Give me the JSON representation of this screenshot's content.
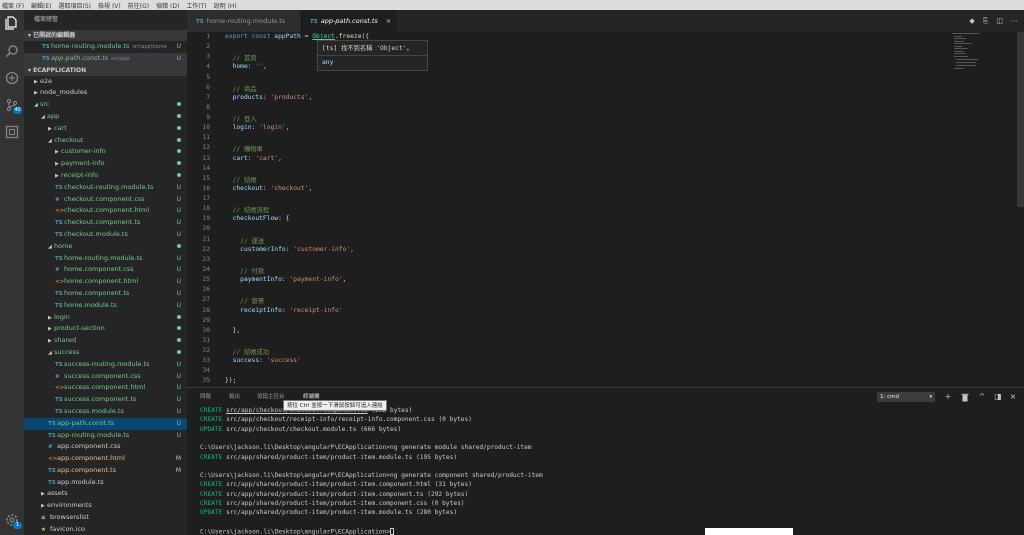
{
  "menu": [
    "檔案 (F)",
    "編輯(E)",
    "選取項目(S)",
    "檢視 (V)",
    "前往(G)",
    "偵錯 (D)",
    "工作(T)",
    "說明 (H)"
  ],
  "activity": {
    "scm_badge": "40",
    "settings_badge": "1"
  },
  "sidebar": {
    "title": "檔案總管",
    "open_editors_header": "已開啟的編輯器",
    "open_editors": [
      {
        "name": "home-routing.module.ts",
        "desc": "src\\app\\home",
        "status": "U"
      },
      {
        "name": "app-path.const.ts",
        "desc": "src\\app",
        "status": "U"
      }
    ],
    "project_header": "ECAPPLICATION",
    "tree": [
      {
        "name": "e2e",
        "type": "folder",
        "level": 0,
        "expanded": false,
        "status": ""
      },
      {
        "name": "node_modules",
        "type": "folder",
        "level": 0,
        "expanded": false,
        "status": ""
      },
      {
        "name": "src",
        "type": "folder",
        "level": 0,
        "expanded": true,
        "status": "dot"
      },
      {
        "name": "app",
        "type": "folder",
        "level": 1,
        "expanded": true,
        "status": "dot"
      },
      {
        "name": "cart",
        "type": "folder",
        "level": 2,
        "expanded": false,
        "status": "dot"
      },
      {
        "name": "checkout",
        "type": "folder",
        "level": 2,
        "expanded": true,
        "status": "dot"
      },
      {
        "name": "customer-info",
        "type": "folder",
        "level": 3,
        "expanded": false,
        "status": "dot"
      },
      {
        "name": "payment-info",
        "type": "folder",
        "level": 3,
        "expanded": false,
        "status": "dot"
      },
      {
        "name": "receipt-info",
        "type": "folder",
        "level": 3,
        "expanded": false,
        "status": "dot"
      },
      {
        "name": "checkout-routing.module.ts",
        "type": "ts",
        "level": 3,
        "status": "U"
      },
      {
        "name": "checkout.component.css",
        "type": "css",
        "level": 3,
        "status": "U"
      },
      {
        "name": "checkout.component.html",
        "type": "html",
        "level": 3,
        "status": "U"
      },
      {
        "name": "checkout.component.ts",
        "type": "ts",
        "level": 3,
        "status": "U"
      },
      {
        "name": "checkout.module.ts",
        "type": "ts",
        "level": 3,
        "status": "U"
      },
      {
        "name": "home",
        "type": "folder",
        "level": 2,
        "expanded": true,
        "status": "dot"
      },
      {
        "name": "home-routing.module.ts",
        "type": "ts",
        "level": 3,
        "status": "U"
      },
      {
        "name": "home.component.css",
        "type": "css",
        "level": 3,
        "status": "U"
      },
      {
        "name": "home.component.html",
        "type": "html",
        "level": 3,
        "status": "U"
      },
      {
        "name": "home.component.ts",
        "type": "ts",
        "level": 3,
        "status": "U"
      },
      {
        "name": "home.module.ts",
        "type": "ts",
        "level": 3,
        "status": "U"
      },
      {
        "name": "login",
        "type": "folder",
        "level": 2,
        "expanded": false,
        "status": "dot"
      },
      {
        "name": "product-section",
        "type": "folder",
        "level": 2,
        "expanded": false,
        "status": "dot"
      },
      {
        "name": "shared",
        "type": "folder",
        "level": 2,
        "expanded": false,
        "status": "dot"
      },
      {
        "name": "success",
        "type": "folder",
        "level": 2,
        "expanded": true,
        "status": "dot"
      },
      {
        "name": "success-routing.module.ts",
        "type": "ts",
        "level": 3,
        "status": "U"
      },
      {
        "name": "success.component.css",
        "type": "css",
        "level": 3,
        "status": "U"
      },
      {
        "name": "success.component.html",
        "type": "html",
        "level": 3,
        "status": "U"
      },
      {
        "name": "success.component.ts",
        "type": "ts",
        "level": 3,
        "status": "U"
      },
      {
        "name": "success.module.ts",
        "type": "ts",
        "level": 3,
        "status": "U"
      },
      {
        "name": "app-path.const.ts",
        "type": "ts",
        "level": 2,
        "status": "U",
        "selected": true
      },
      {
        "name": "app-routing.module.ts",
        "type": "ts",
        "level": 2,
        "status": "U"
      },
      {
        "name": "app.component.css",
        "type": "css",
        "level": 2,
        "status": ""
      },
      {
        "name": "app.component.html",
        "type": "html",
        "level": 2,
        "status": "M"
      },
      {
        "name": "app.component.ts",
        "type": "ts",
        "level": 2,
        "status": "M"
      },
      {
        "name": "app.module.ts",
        "type": "ts",
        "level": 2,
        "status": ""
      },
      {
        "name": "assets",
        "type": "folder",
        "level": 1,
        "expanded": false,
        "status": ""
      },
      {
        "name": "environments",
        "type": "folder",
        "level": 1,
        "expanded": false,
        "status": ""
      },
      {
        "name": "browserslist",
        "type": "file",
        "level": 1,
        "status": ""
      },
      {
        "name": "favicon.ico",
        "type": "star",
        "level": 1,
        "status": ""
      }
    ]
  },
  "tabs": [
    {
      "label": "home-routing.module.ts",
      "active": false
    },
    {
      "label": "app-path.const.ts",
      "active": true
    }
  ],
  "editor": {
    "lines": [
      {
        "n": "1",
        "t": [
          [
            "k",
            "export "
          ],
          [
            "k",
            "const "
          ],
          [
            "v",
            "appPath"
          ],
          [
            "p",
            " = "
          ],
          [
            "obj",
            "Object"
          ],
          [
            "p",
            "."
          ],
          [
            "f",
            "freeze"
          ],
          [
            "p",
            "({"
          ]
        ]
      },
      {
        "n": "2",
        "t": []
      },
      {
        "n": "3",
        "t": [
          [
            "c",
            "  // 首頁"
          ]
        ]
      },
      {
        "n": "4",
        "t": [
          [
            "v",
            "  home"
          ],
          [
            "p",
            ": "
          ],
          [
            "s",
            "''"
          ],
          [
            "p",
            ","
          ]
        ]
      },
      {
        "n": "5",
        "t": []
      },
      {
        "n": "6",
        "t": [
          [
            "c",
            "  // 商品"
          ]
        ]
      },
      {
        "n": "7",
        "t": [
          [
            "v",
            "  products"
          ],
          [
            "p",
            ": "
          ],
          [
            "s",
            "'products'"
          ],
          [
            "p",
            ","
          ]
        ]
      },
      {
        "n": "8",
        "t": []
      },
      {
        "n": "9",
        "t": [
          [
            "c",
            "  // 登入"
          ]
        ]
      },
      {
        "n": "10",
        "t": [
          [
            "v",
            "  login"
          ],
          [
            "p",
            ": "
          ],
          [
            "s",
            "'login'"
          ],
          [
            "p",
            ","
          ]
        ]
      },
      {
        "n": "11",
        "t": []
      },
      {
        "n": "12",
        "t": [
          [
            "c",
            "  // 購物車"
          ]
        ]
      },
      {
        "n": "13",
        "t": [
          [
            "v",
            "  cart"
          ],
          [
            "p",
            ": "
          ],
          [
            "s",
            "'cart'"
          ],
          [
            "p",
            ","
          ]
        ]
      },
      {
        "n": "14",
        "t": []
      },
      {
        "n": "15",
        "t": [
          [
            "c",
            "  // 結帳"
          ]
        ]
      },
      {
        "n": "16",
        "t": [
          [
            "v",
            "  checkout"
          ],
          [
            "p",
            ": "
          ],
          [
            "s",
            "'checkout'"
          ],
          [
            "p",
            ","
          ]
        ]
      },
      {
        "n": "17",
        "t": []
      },
      {
        "n": "18",
        "t": [
          [
            "c",
            "  // 結帳流程"
          ]
        ]
      },
      {
        "n": "19",
        "t": [
          [
            "v",
            "  checkoutFlow"
          ],
          [
            "p",
            ": {"
          ]
        ]
      },
      {
        "n": "20",
        "t": []
      },
      {
        "n": "21",
        "t": [
          [
            "c",
            "    // 運送"
          ]
        ]
      },
      {
        "n": "22",
        "t": [
          [
            "v",
            "    customerInfo"
          ],
          [
            "p",
            ": "
          ],
          [
            "s",
            "'customer-info'"
          ],
          [
            "p",
            ","
          ]
        ]
      },
      {
        "n": "23",
        "t": []
      },
      {
        "n": "24",
        "t": [
          [
            "c",
            "    // 付款"
          ]
        ]
      },
      {
        "n": "25",
        "t": [
          [
            "v",
            "    paymentInfo"
          ],
          [
            "p",
            ": "
          ],
          [
            "s",
            "'payment-info'"
          ],
          [
            "p",
            ","
          ]
        ]
      },
      {
        "n": "26",
        "t": []
      },
      {
        "n": "27",
        "t": [
          [
            "c",
            "    // 發票"
          ]
        ]
      },
      {
        "n": "28",
        "t": [
          [
            "v",
            "    receiptInfo"
          ],
          [
            "p",
            ": "
          ],
          [
            "s",
            "'receipt-info'"
          ]
        ]
      },
      {
        "n": "29",
        "t": []
      },
      {
        "n": "30",
        "t": [
          [
            "p",
            "  },"
          ]
        ]
      },
      {
        "n": "31",
        "t": []
      },
      {
        "n": "32",
        "t": [
          [
            "c",
            "  // 結帳成功"
          ]
        ]
      },
      {
        "n": "33",
        "t": [
          [
            "v",
            "  success"
          ],
          [
            "p",
            ": "
          ],
          [
            "s",
            "'success'"
          ]
        ]
      },
      {
        "n": "34",
        "t": []
      },
      {
        "n": "35",
        "t": [
          [
            "p",
            "});"
          ]
        ]
      }
    ],
    "hover_title": "[ts] 找不到名稱 'Object'。",
    "hover_type": "any"
  },
  "panel": {
    "tabs": [
      "問題",
      "輸出",
      "偵錯主控台",
      "終端機"
    ],
    "active_tab": "終端機",
    "terminal_select": "1: cmd",
    "tooltip": "按住 Ctrl 並按一下滑鼠按鈕可追入連結",
    "lines": [
      {
        "kind": "CREATE",
        "path": "src/app/checkout/checkout.component.ts",
        "rest": " (292 bytes)"
      },
      {
        "kind": "CREATE",
        "path": "src/app/checkout/receipt-info/receipt-info.component.css",
        "rest": " (0 bytes)"
      },
      {
        "kind": "UPDATE",
        "path": "src/app/checkout/checkout.module.ts",
        "rest": " (666 bytes)"
      },
      {
        "kind": "",
        "path": "",
        "rest": ""
      },
      {
        "kind": "",
        "path": "",
        "rest": "C:\\Users\\jackson.li\\Desktop\\angularP\\ECApplication>ng generate module shared/product-item"
      },
      {
        "kind": "CREATE",
        "path": "src/app/shared/product-item/product-item.module.ts",
        "rest": " (195 bytes)"
      },
      {
        "kind": "",
        "path": "",
        "rest": ""
      },
      {
        "kind": "",
        "path": "",
        "rest": "C:\\Users\\jackson.li\\Desktop\\angularP\\ECApplication>ng generate component shared/product-item"
      },
      {
        "kind": "CREATE",
        "path": "src/app/shared/product-item/product-item.component.html",
        "rest": " (31 bytes)"
      },
      {
        "kind": "CREATE",
        "path": "src/app/shared/product-item/product-item.component.ts",
        "rest": " (292 bytes)"
      },
      {
        "kind": "CREATE",
        "path": "src/app/shared/product-item/product-item.component.css",
        "rest": " (0 bytes)"
      },
      {
        "kind": "UPDATE",
        "path": "src/app/shared/product-item/product-item.module.ts",
        "rest": " (280 bytes)"
      },
      {
        "kind": "",
        "path": "",
        "rest": ""
      },
      {
        "kind": "",
        "path": "",
        "rest": "C:\\Users\\jackson.li\\Desktop\\angularP\\ECApplication>"
      }
    ]
  }
}
